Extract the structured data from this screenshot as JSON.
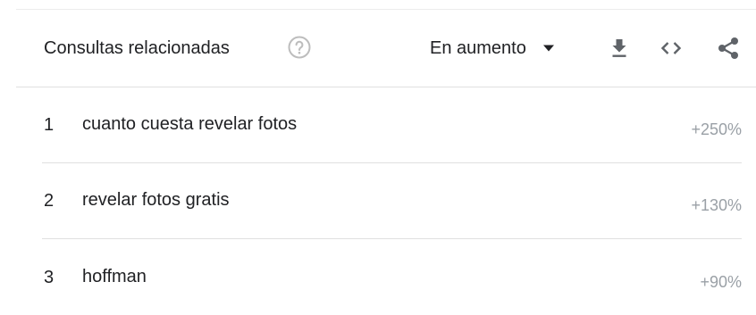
{
  "header": {
    "title": "Consultas relacionadas",
    "help_icon": "help-circle-icon",
    "dropdown": {
      "selected": "En aumento",
      "caret_icon": "caret-down-icon"
    },
    "tools": [
      {
        "name": "download",
        "icon": "download-icon"
      },
      {
        "name": "embed",
        "icon": "embed-code-icon"
      },
      {
        "name": "share",
        "icon": "share-icon"
      }
    ]
  },
  "rows": [
    {
      "index": "1",
      "query": "cuanto cuesta revelar fotos",
      "value": "+250%"
    },
    {
      "index": "2",
      "query": "revelar fotos gratis",
      "value": "+130%"
    },
    {
      "index": "3",
      "query": "hoffman",
      "value": "+90%"
    }
  ],
  "colors": {
    "text": "#202124",
    "muted": "#9aa0a6",
    "divider": "#e0e0e0",
    "icon": "#5f6368",
    "help_icon": "#bdbdbd"
  }
}
